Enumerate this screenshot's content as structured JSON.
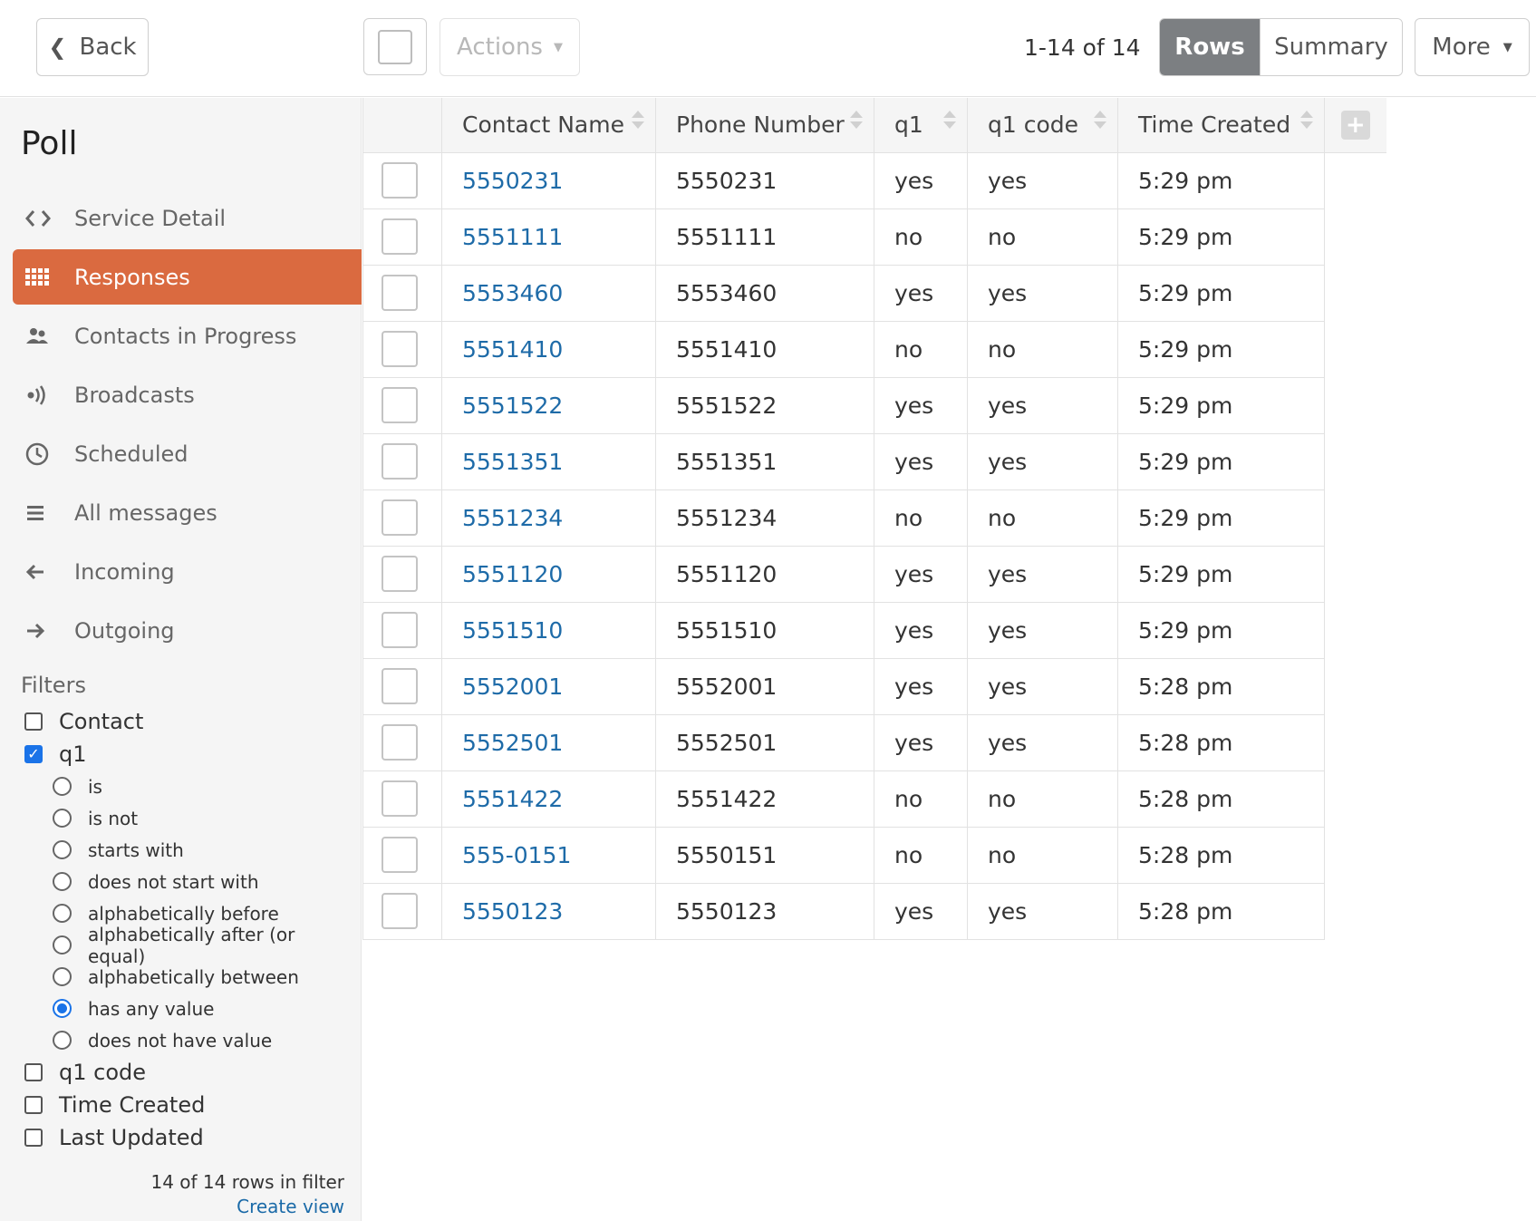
{
  "toolbar": {
    "back_label": "Back",
    "actions_label": "Actions",
    "pager_text": "1-14 of 14",
    "rows_label": "Rows",
    "summary_label": "Summary",
    "more_label": "More"
  },
  "sidebar": {
    "title": "Poll",
    "nav": [
      {
        "label": "Service Detail",
        "icon": "code-icon",
        "active": false
      },
      {
        "label": "Responses",
        "icon": "grid-icon",
        "active": true
      },
      {
        "label": "Contacts in Progress",
        "icon": "users-icon",
        "active": false
      },
      {
        "label": "Broadcasts",
        "icon": "broadcast-icon",
        "active": false
      },
      {
        "label": "Scheduled",
        "icon": "clock-icon",
        "active": false
      },
      {
        "label": "All messages",
        "icon": "list-icon",
        "active": false
      },
      {
        "label": "Incoming",
        "icon": "arrow-left-icon",
        "active": false
      },
      {
        "label": "Outgoing",
        "icon": "arrow-right-icon",
        "active": false
      }
    ],
    "filters_label": "Filters",
    "filters": {
      "contact": {
        "label": "Contact",
        "checked": false
      },
      "q1": {
        "label": "q1",
        "checked": true,
        "options": [
          {
            "label": "is",
            "selected": false
          },
          {
            "label": "is not",
            "selected": false
          },
          {
            "label": "starts with",
            "selected": false
          },
          {
            "label": "does not start with",
            "selected": false
          },
          {
            "label": "alphabetically before",
            "selected": false
          },
          {
            "label": "alphabetically after (or equal)",
            "selected": false
          },
          {
            "label": "alphabetically between",
            "selected": false
          },
          {
            "label": "has any value",
            "selected": true
          },
          {
            "label": "does not have value",
            "selected": false
          }
        ]
      },
      "q1_code": {
        "label": "q1 code",
        "checked": false
      },
      "time_created": {
        "label": "Time Created",
        "checked": false
      },
      "last_updated": {
        "label": "Last Updated",
        "checked": false
      }
    },
    "rows_count": "14 of 14 rows in filter",
    "create_view": "Create view"
  },
  "table": {
    "columns": [
      "Contact Name",
      "Phone Number",
      "q1",
      "q1 code",
      "Time Created"
    ],
    "rows": [
      [
        "5550231",
        "5550231",
        "yes",
        "yes",
        "5:29 pm"
      ],
      [
        "5551111",
        "5551111",
        "no",
        "no",
        "5:29 pm"
      ],
      [
        "5553460",
        "5553460",
        "yes",
        "yes",
        "5:29 pm"
      ],
      [
        "5551410",
        "5551410",
        "no",
        "no",
        "5:29 pm"
      ],
      [
        "5551522",
        "5551522",
        "yes",
        "yes",
        "5:29 pm"
      ],
      [
        "5551351",
        "5551351",
        "yes",
        "yes",
        "5:29 pm"
      ],
      [
        "5551234",
        "5551234",
        "no",
        "no",
        "5:29 pm"
      ],
      [
        "5551120",
        "5551120",
        "yes",
        "yes",
        "5:29 pm"
      ],
      [
        "5551510",
        "5551510",
        "yes",
        "yes",
        "5:29 pm"
      ],
      [
        "5552001",
        "5552001",
        "yes",
        "yes",
        "5:28 pm"
      ],
      [
        "5552501",
        "5552501",
        "yes",
        "yes",
        "5:28 pm"
      ],
      [
        "5551422",
        "5551422",
        "no",
        "no",
        "5:28 pm"
      ],
      [
        "555-0151",
        "5550151",
        "no",
        "no",
        "5:28 pm"
      ],
      [
        "5550123",
        "5550123",
        "yes",
        "yes",
        "5:28 pm"
      ]
    ]
  },
  "colors": {
    "accent": "#da6a40",
    "link": "#1e6ba8",
    "rows_active": "#7c7f82",
    "checkbox": "#1a73e8"
  }
}
